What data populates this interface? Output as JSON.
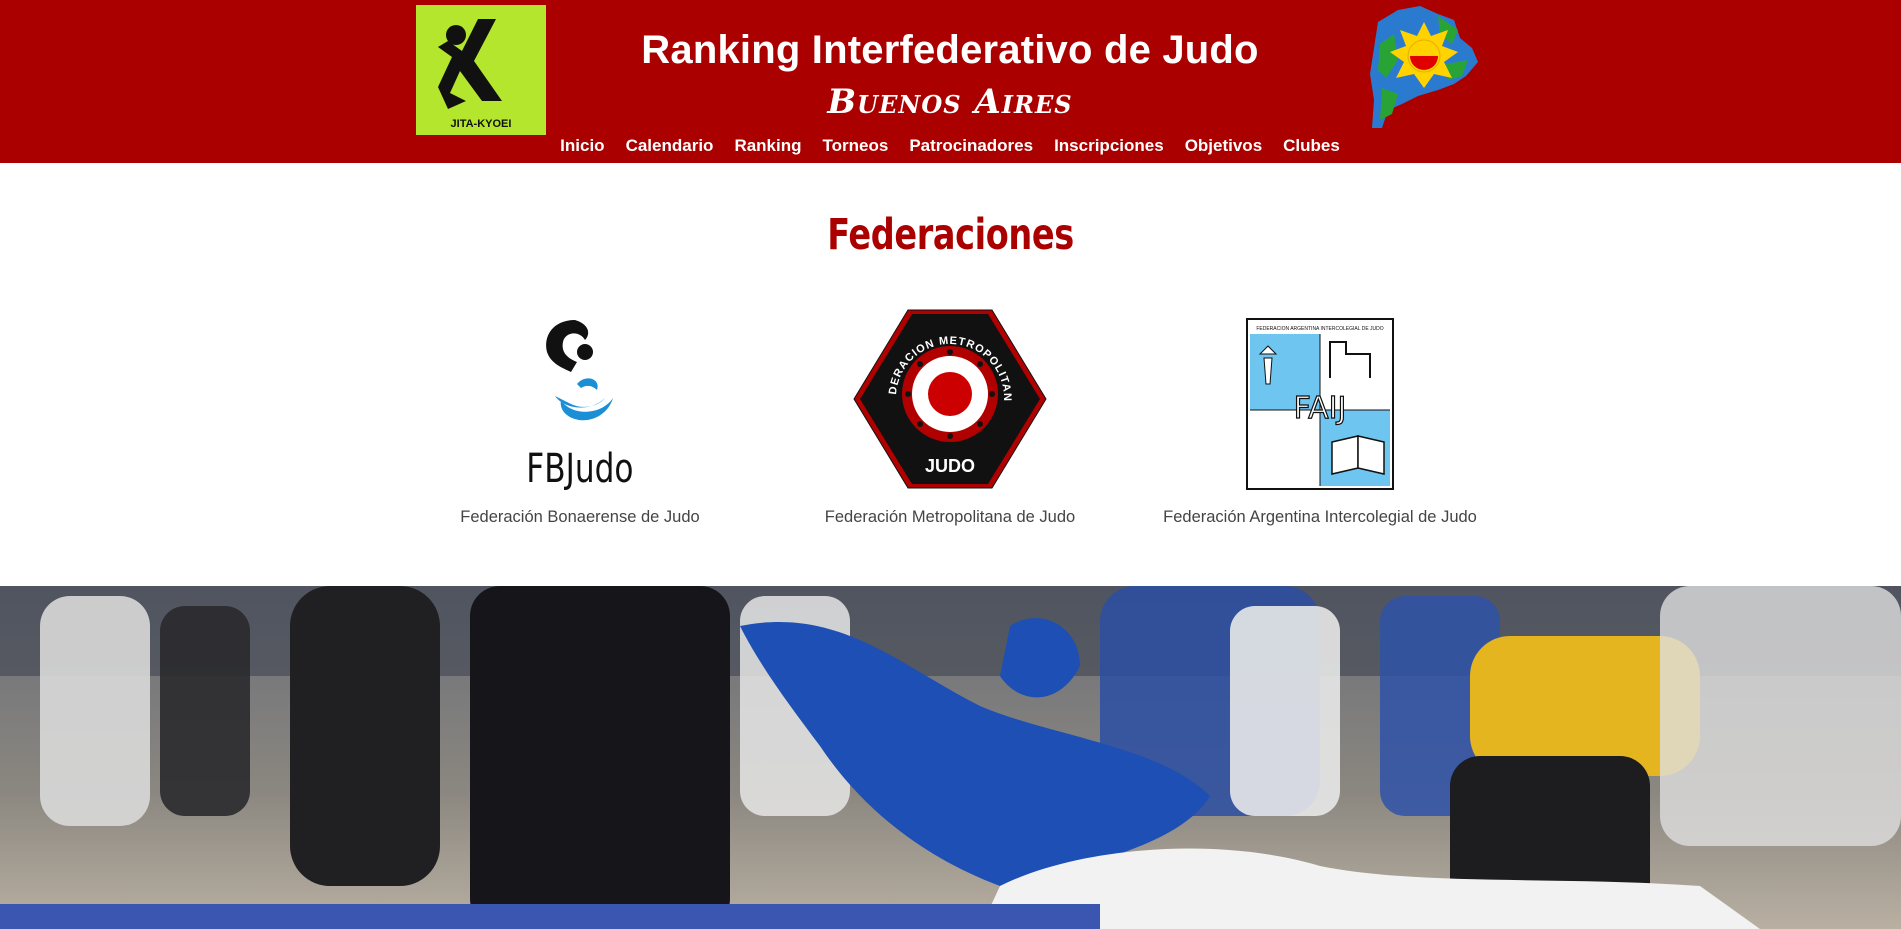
{
  "header": {
    "title": "Ranking Interfederativo de Judo",
    "subtitle": "Buenos Aires",
    "logo_left": {
      "icon": "jita-kyoei-logo",
      "text": "JITA-KYOEI",
      "bg": "#b3e62c"
    },
    "logo_right": {
      "icon": "buenos-aires-province-logo"
    },
    "bg_color": "#ab0000"
  },
  "nav": {
    "items": [
      "Inicio",
      "Calendario",
      "Ranking",
      "Torneos",
      "Patrocinadores",
      "Inscripciones",
      "Objetivos",
      "Clubes"
    ]
  },
  "federaciones": {
    "title": "Federaciones",
    "items": [
      {
        "name": "Federación Bonaerense de Judo",
        "logo_text": "FBJudo",
        "icon": "fbjudo-logo"
      },
      {
        "name": "Federación Metropolitana de Judo",
        "logo_text": "FEDERACION METROPOLITANA",
        "logo_subtext": "JUDO",
        "icon": "fmj-logo"
      },
      {
        "name": "Federación Argentina Intercolegial de Judo",
        "logo_text": "FAIJ",
        "logo_header": "FEDERACION ARGENTINA INTERCOLEGIAL DE JUDO",
        "icon": "faij-logo"
      }
    ]
  },
  "hero": {
    "icon": "judo-match-photo"
  }
}
